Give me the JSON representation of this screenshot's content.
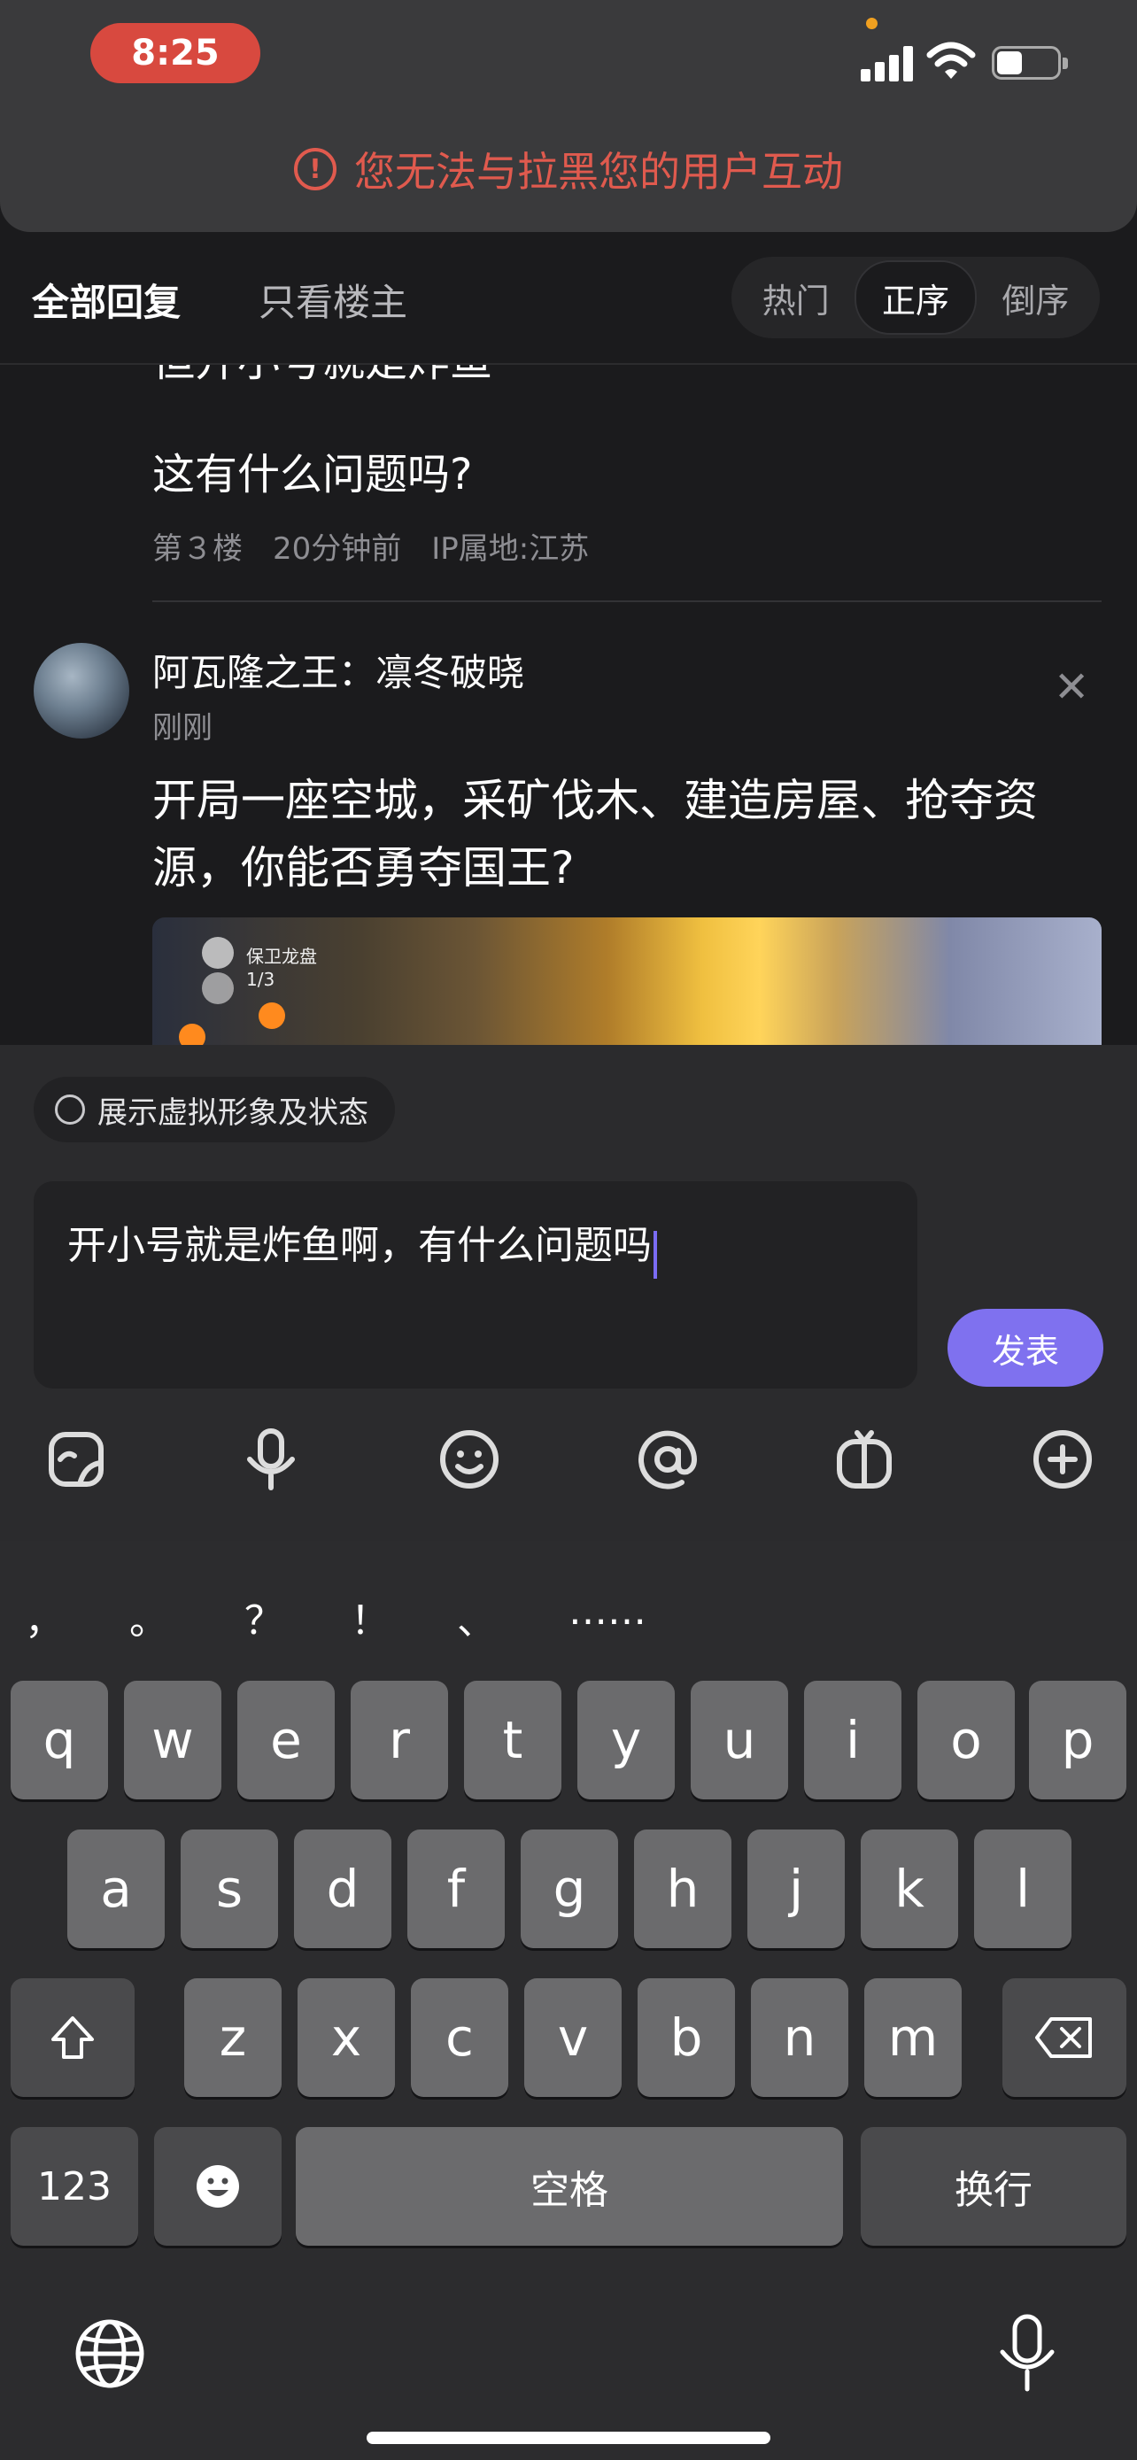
{
  "status_bar": {
    "time": "8:25"
  },
  "toast": {
    "icon": "exclamation-circle-icon",
    "text": "您无法与拉黑您的用户互动"
  },
  "filter": {
    "tabs": [
      "全部回复",
      "只看楼主"
    ],
    "sort_options": [
      "热门",
      "正序",
      "倒序"
    ],
    "active_sort": "正序"
  },
  "feed": {
    "cut_off_text": "但开小号就是炸鱼",
    "reply_text": "这有什么问题吗?",
    "reply_meta": "第３楼　20分钟前　IP属地:江苏",
    "post": {
      "author": "阿瓦隆之王：凛冬破晓",
      "time": "刚刚",
      "body": "开局一座空城，采矿伐木、建造房屋、抢夺资源，你能否勇夺国王?",
      "image_text_1": "保卫龙盘",
      "image_text_2": "1/3"
    }
  },
  "composer": {
    "avatar_toggle_label": "展示虚拟形象及状态",
    "input_value": "开小号就是炸鱼啊，有什么问题吗",
    "submit_label": "发表",
    "tools": [
      "sticker-icon",
      "microphone-icon",
      "emoji-icon",
      "at-icon",
      "gift-icon",
      "plus-circle-icon"
    ]
  },
  "keyboard": {
    "punctuation": [
      "，",
      "。",
      "？",
      "！",
      "、",
      "……"
    ],
    "row1": [
      "q",
      "w",
      "e",
      "r",
      "t",
      "y",
      "u",
      "i",
      "o",
      "p"
    ],
    "row2": [
      "a",
      "s",
      "d",
      "f",
      "g",
      "h",
      "j",
      "k",
      "l"
    ],
    "row3": [
      "z",
      "x",
      "c",
      "v",
      "b",
      "n",
      "m"
    ],
    "numbers_key": "123",
    "space_label": "空格",
    "return_label": "换行"
  }
}
